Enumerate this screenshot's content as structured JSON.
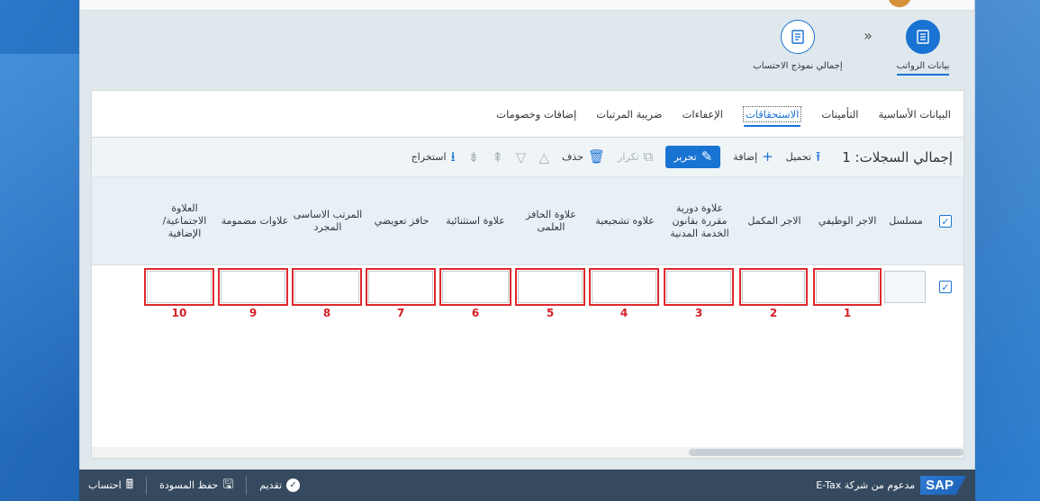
{
  "wizard": {
    "steps": [
      {
        "label": "بيانات الرواتب",
        "icon": "list-icon",
        "active": true
      },
      {
        "label": "إجمالي نموذج الاحتساب",
        "icon": "document-icon",
        "active": false
      }
    ],
    "separator": "«"
  },
  "tabs": [
    {
      "label": "البيانات الأساسية",
      "active": false
    },
    {
      "label": "التأمينات",
      "active": false
    },
    {
      "label": "الاستحقاقات",
      "active": true
    },
    {
      "label": "الإعفاءات",
      "active": false
    },
    {
      "label": "ضريبة المرتبات",
      "active": false
    },
    {
      "label": "إضافات وخصومات",
      "active": false
    }
  ],
  "toolbar": {
    "total_label": "إجمالي السجلات:",
    "total_count": "1",
    "upload_label": "تحميل",
    "add_label": "إضافة",
    "edit_label": "تحرير",
    "duplicate_label": "تكرار",
    "delete_label": "حذف",
    "export_label": "استخراج"
  },
  "table": {
    "columns": [
      "مسلسل",
      "الاجر الوظيفي",
      "الاجر المكمل",
      "علاوة دورية مقررة بقانون الخدمة المدنية",
      "علاوه تشجيعية",
      "علاوة الحافز العلمى",
      "علاوة استثنائية",
      "حافز تعويضي",
      "المرتب الاساسى المجرد",
      "علاوات مضمومة",
      "العلاوة الاجتماعية/ الإضافية"
    ],
    "row_numbers": [
      "1",
      "2",
      "3",
      "4",
      "5",
      "6",
      "7",
      "8",
      "9",
      "10"
    ]
  },
  "footer": {
    "brand": "SAP",
    "powered_by": "مدعوم من شركة E-Tax",
    "calculate_label": "احتساب",
    "save_draft_label": "حفظ المسودة",
    "submit_label": "تقديم"
  },
  "colors": {
    "accent": "#1873d3",
    "highlight_red": "#e0282e",
    "footer_bg": "#354a5f"
  }
}
